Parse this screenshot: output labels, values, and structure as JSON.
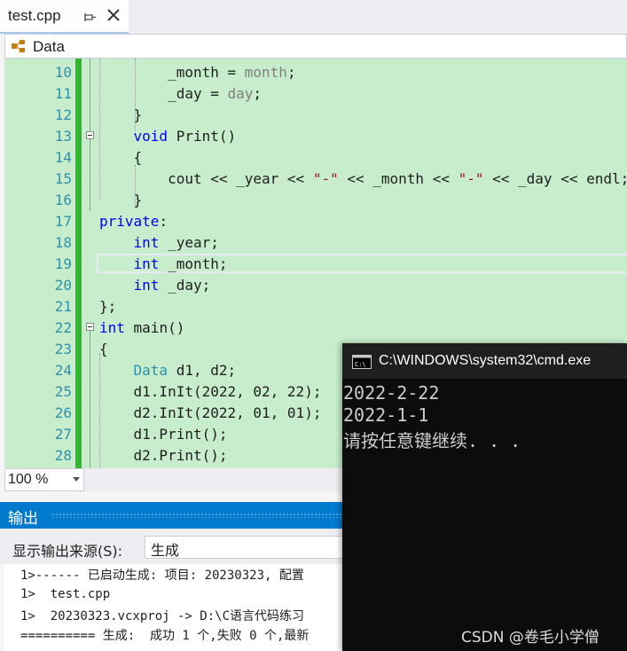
{
  "tab": {
    "title": "test.cpp"
  },
  "nav": {
    "class_name": "Data"
  },
  "editor": {
    "line_numbers": [
      "10",
      "11",
      "12",
      "13",
      "14",
      "15",
      "16",
      "17",
      "18",
      "19",
      "20",
      "21",
      "22",
      "23",
      "24",
      "25",
      "26",
      "27",
      "28"
    ],
    "lines": [
      [
        {
          "t": "        _month = "
        },
        {
          "t": "month",
          "c": "pm"
        },
        {
          "t": ";"
        }
      ],
      [
        {
          "t": "        _day = "
        },
        {
          "t": "day",
          "c": "pm"
        },
        {
          "t": ";"
        }
      ],
      [
        {
          "t": "    }"
        }
      ],
      [
        {
          "t": "    "
        },
        {
          "t": "void",
          "c": "kw"
        },
        {
          "t": " Print()"
        }
      ],
      [
        {
          "t": "    {"
        }
      ],
      [
        {
          "t": "        cout << _year << "
        },
        {
          "t": "\"-\"",
          "c": "st"
        },
        {
          "t": " << _month << "
        },
        {
          "t": "\"-\"",
          "c": "st"
        },
        {
          "t": " << _day << endl;"
        }
      ],
      [
        {
          "t": "    }"
        }
      ],
      [
        {
          "t": "private",
          "c": "kw"
        },
        {
          "t": ":"
        }
      ],
      [
        {
          "t": "    "
        },
        {
          "t": "int",
          "c": "kw"
        },
        {
          "t": " _year;"
        }
      ],
      [
        {
          "t": "    "
        },
        {
          "t": "int",
          "c": "kw"
        },
        {
          "t": " _month;"
        }
      ],
      [
        {
          "t": "    "
        },
        {
          "t": "int",
          "c": "kw"
        },
        {
          "t": " _day;"
        }
      ],
      [
        {
          "t": "};"
        }
      ],
      [
        {
          "t": "int",
          "c": "kw"
        },
        {
          "t": " main()"
        }
      ],
      [
        {
          "t": "{"
        }
      ],
      [
        {
          "t": "    "
        },
        {
          "t": "Data",
          "c": "ty"
        },
        {
          "t": " d1, d2;"
        }
      ],
      [
        {
          "t": "    d1.InIt(2022, 02, 22);"
        }
      ],
      [
        {
          "t": "    d2.InIt(2022, 01, 01);"
        }
      ],
      [
        {
          "t": "    d1.Print();"
        }
      ],
      [
        {
          "t": "    d2.Print();"
        }
      ]
    ]
  },
  "zoom": {
    "value": "100 %"
  },
  "output": {
    "title": "输出",
    "source_label": "显示输出来源(S):",
    "source_value": "生成",
    "lines": [
      "1>------ 已启动生成: 项目: 20230323, 配置",
      "1>  test.cpp",
      "1>  20230323.vcxproj -> D:\\C语言代码练习",
      "========== 生成:  成功 1 个,失败 0 个,最新"
    ]
  },
  "cmd": {
    "title": "C:\\WINDOWS\\system32\\cmd.exe",
    "lines": [
      "2022-2-22",
      "2022-1-1",
      "请按任意键继续. . ."
    ]
  },
  "watermark": "CSDN @卷毛小学僧",
  "colors": {
    "accent": "#007acc",
    "editor_bg": "#c7edcc",
    "change_bar": "#2eb82e",
    "keyword": "#0000ff",
    "string": "#a31515"
  }
}
